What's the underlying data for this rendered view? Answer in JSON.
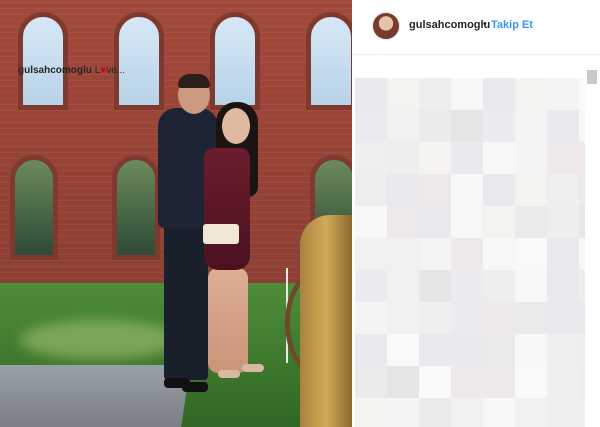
{
  "post": {
    "header": {
      "username": "gulsahcomoglu",
      "separator": "•",
      "follow_label": "Takip Et"
    },
    "caption": {
      "username": "gulsahcomoglu",
      "text_before_heart": "L",
      "heart": "♥",
      "text_after_heart": "ve..."
    }
  },
  "icons": {
    "avatar": "profile-avatar",
    "heart": "heart-icon"
  },
  "colors": {
    "follow_link": "#3897f0",
    "heart": "#d0021b",
    "text": "#262626"
  }
}
